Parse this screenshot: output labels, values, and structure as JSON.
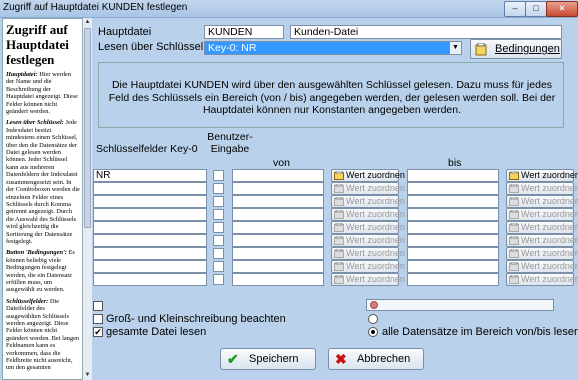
{
  "window": {
    "title": "Zugriff auf Hauptdatei KUNDEN festlegen",
    "btn_min": "–",
    "btn_max": "□",
    "btn_close": "×"
  },
  "help": {
    "heading": "Zugriff auf Hauptdatei festlegen",
    "paragraphs": [
      {
        "title": "Hauptdatei:",
        "text": " Hier werden der Name und die Beschreibung der Hauptdatei angezeigt. Diese Felder können nicht geändert werden."
      },
      {
        "title": "Lesen über Schlüssel:",
        "text": " Jede Indexdatei besitzt mindestens einen Schlüssel, über den die Datensätze der Datei gelesen werden können. Jeder Schlüssel kann aus mehreren Datenfeldern der Indexdatei zusammengesetzt sein. In der Comboboxen werden die einzelnen Felder eines Schlüssels durch Komma getrennt angezeigt. Durch die Auswahl des Schlüssels wird gleichzeitig die Sortierung der Datensätze festgelegt."
      },
      {
        "title": "Button 'Bedingungen':",
        "text": " Es können beliebig viele Bedingungen festgelegt werden, die ein Datensatz erfüllen muss, um ausgewählt zu werden."
      },
      {
        "title": "Schlüsselfelder:",
        "text": " Die Dateifelder des ausgewählten Schlüssels werden angezeigt. Diese Felder können nicht geändert werden. Bei langen Feldnamen kann es vorkommen, dass die Feldbreite nicht ausreicht, um den gesamten"
      }
    ]
  },
  "form": {
    "hauptdatei_label": "Hauptdatei",
    "hauptdatei_name": "KUNDEN",
    "hauptdatei_desc": "Kunden-Datei",
    "lesen_label": "Lesen über Schlüssel",
    "schluessel_value": "Key-0: NR",
    "bedingungen_label": "Bedingungen",
    "info_text": "Die Hauptdatei KUNDEN  wird über den ausgewählten Schlüssel gelesen. Dazu muss für jedes Feld des Schlüssels ein Bereich (von / bis) angegeben werden, der gelesen werden soll. Bei der Hauptdatei können nur Konstanten angegeben werden."
  },
  "table": {
    "col_key": "Schlüsselfelder Key-0",
    "col_user": "Benutzer-Eingabe",
    "col_von": "von",
    "col_bis": "bis",
    "wert_label": "Wert zuordnen",
    "rows": [
      {
        "key": "NR",
        "enabled": true
      },
      {
        "key": "",
        "enabled": false
      },
      {
        "key": "",
        "enabled": false
      },
      {
        "key": "",
        "enabled": false
      },
      {
        "key": "",
        "enabled": false
      },
      {
        "key": "",
        "enabled": false
      },
      {
        "key": "",
        "enabled": false
      },
      {
        "key": "",
        "enabled": false
      },
      {
        "key": "",
        "enabled": false
      }
    ]
  },
  "options": {
    "gross_klein": "Groß- und Kleinschreibung beachten",
    "gesamte_datei": "gesamte Datei lesen",
    "alle_datensaetze": "alle Datensätze im Bereich von/bis lesen"
  },
  "buttons": {
    "save": "Speichern",
    "cancel": "Abbrechen"
  },
  "colors": {
    "accent": "#3399ff",
    "background": "#b9d1ea",
    "save_icon": "#1a9b1a",
    "cancel_icon": "#cc1111"
  }
}
